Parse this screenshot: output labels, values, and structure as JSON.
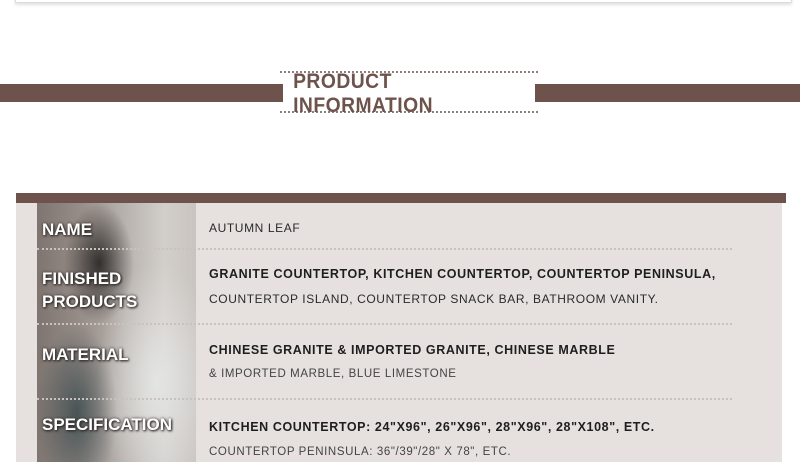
{
  "banner": {
    "title": "PRODUCT INFORMATION"
  },
  "colors": {
    "accent": "#6e534d",
    "panel": "#e6e1de",
    "text": "#2a2a2a"
  },
  "product_info": {
    "rows": [
      {
        "label_lines": [
          "NAME"
        ],
        "lines": [
          "AUTUMN LEAF"
        ]
      },
      {
        "label_lines": [
          "FINISHED",
          "PRODUCTS"
        ],
        "lines": [
          "GRANITE COUNTERTOP, KITCHEN COUNTERTOP, COUNTERTOP PENINSULA,",
          "COUNTERTOP ISLAND, COUNTERTOP SNACK BAR, BATHROOM VANITY."
        ]
      },
      {
        "label_lines": [
          "MATERIAL"
        ],
        "lines": [
          "CHINESE GRANITE & IMPORTED GRANITE, CHINESE MARBLE",
          "& IMPORTED MARBLE, BLUE LIMESTONE"
        ]
      },
      {
        "label_lines": [
          "SPECIFICATION"
        ],
        "lines": [
          "KITCHEN COUNTERTOP: 24\"X96\", 26\"X96\", 28\"X96\", 28\"X108\", ETC.",
          "COUNTERTOP PENINSULA: 36\"/39\"/28\" X 78\", ETC."
        ]
      }
    ]
  }
}
